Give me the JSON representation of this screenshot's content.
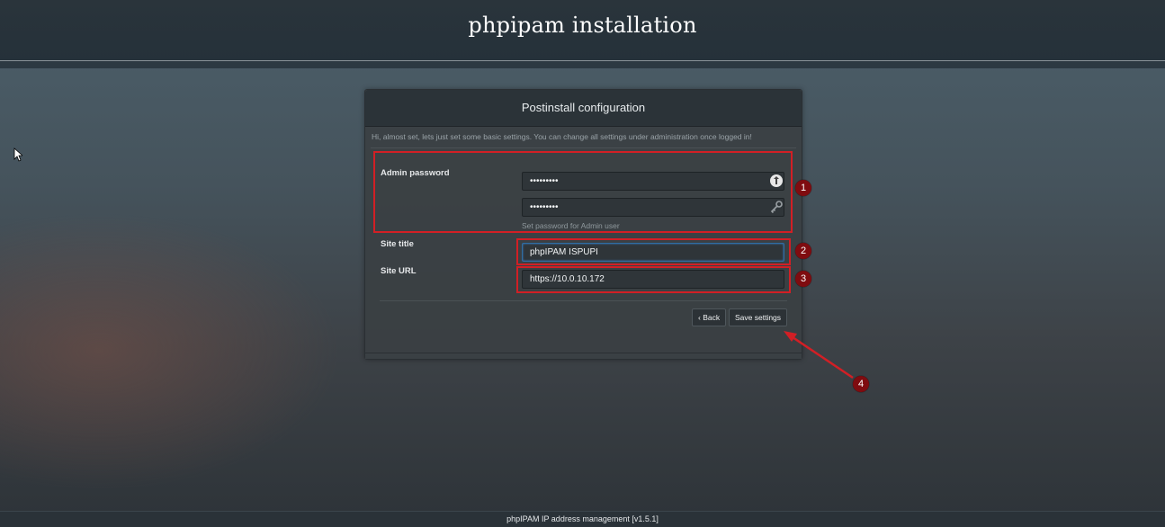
{
  "header": {
    "title": "phpipam installation"
  },
  "panel": {
    "title": "Postinstall configuration",
    "intro": "Hi, almost set, lets just set some basic settings. You can change all settings under administration once logged in!"
  },
  "form": {
    "admin_password": {
      "label": "Admin password",
      "value": "•••••••••",
      "confirm_value": "•••••••••",
      "help": "Set password for Admin user"
    },
    "site_title": {
      "label": "Site title",
      "value": "phpIPAM ISPUPI"
    },
    "site_url": {
      "label": "Site URL",
      "value": "https://10.0.10.172"
    }
  },
  "buttons": {
    "back": "‹ Back",
    "save": "Save settings"
  },
  "annotations": {
    "m1": "1",
    "m2": "2",
    "m3": "3",
    "m4": "4"
  },
  "footer": {
    "text": "phpIPAM IP address management [v1.5.1]"
  },
  "colors": {
    "annotation_red": "#d21f25",
    "marker_bg": "#7f0c10"
  }
}
